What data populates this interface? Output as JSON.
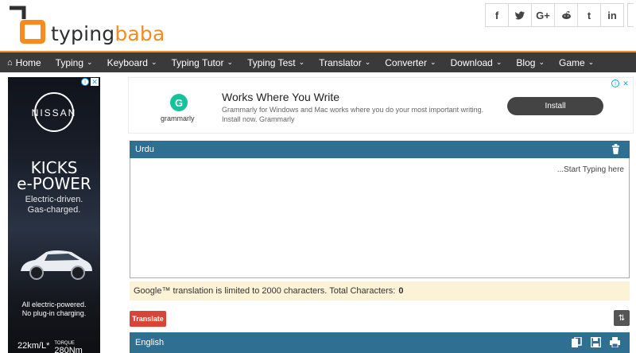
{
  "header": {
    "logo_text_1": "typing",
    "logo_text_2": "baba",
    "social": [
      "f",
      "t",
      "G+",
      "r",
      "t",
      "in"
    ],
    "social_icons": [
      "facebook-icon",
      "twitter-icon",
      "google-plus-icon",
      "reddit-icon",
      "tumblr-icon",
      "linkedin-icon"
    ]
  },
  "nav": {
    "items": [
      {
        "label": "Home",
        "icon": "home-icon",
        "dropdown": false
      },
      {
        "label": "Typing",
        "dropdown": true
      },
      {
        "label": "Keyboard",
        "dropdown": true
      },
      {
        "label": "Typing Tutor",
        "dropdown": true
      },
      {
        "label": "Typing Test",
        "dropdown": true
      },
      {
        "label": "Translator",
        "dropdown": true
      },
      {
        "label": "Converter",
        "dropdown": true
      },
      {
        "label": "Download",
        "dropdown": true
      },
      {
        "label": "Blog",
        "dropdown": true
      },
      {
        "label": "Game",
        "dropdown": true
      }
    ]
  },
  "side_ad": {
    "brand": "NISSAN",
    "headline_1": "KICKS",
    "headline_2": "e-POWER",
    "tag_1": "Electric-driven.",
    "tag_2": "Gas-charged.",
    "bottom_1": "All electric-powered.",
    "bottom_2": "No plug-in charging.",
    "spec_1": "22km/L*",
    "spec_2_label": "TORQUE",
    "spec_2": "280Nm"
  },
  "top_ad": {
    "brand": "grammarly",
    "title": "Works Where You Write",
    "description": "Grammarly for Windows and Mac works where you do your most important writing. Install now. Grammarly",
    "install_label": "Install"
  },
  "translator": {
    "source_lang": "Urdu",
    "placeholder": "...Start Typing here",
    "limit_text": "Google™ translation is limited to 2000 characters. Total Characters:",
    "total_chars": "0",
    "translate_label": "Translate",
    "target_lang": "English"
  },
  "colors": {
    "accent": "#f68b1f",
    "nav_bg": "#3a3a3a",
    "panel_bar": "#2f6f92",
    "translate_btn": "#d9443a",
    "notice_bg": "#fcf3d6"
  }
}
